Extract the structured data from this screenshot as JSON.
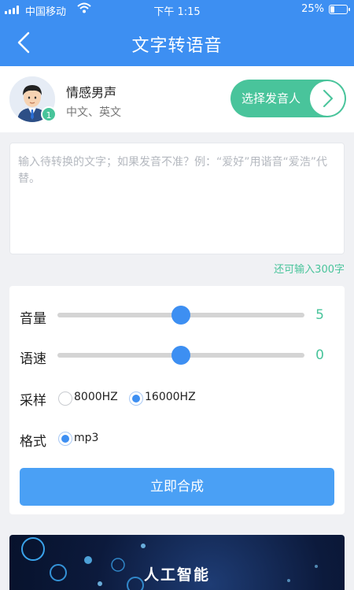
{
  "status_bar": {
    "carrier": "中国移动",
    "time": "下午 1:15",
    "battery_percent": "25%",
    "battery_level": 0.25,
    "icons": [
      "signal-icon",
      "wifi-icon",
      "battery-icon"
    ]
  },
  "header": {
    "title": "文字转语音",
    "back_icon": "chevron-left-icon"
  },
  "voice": {
    "name": "情感男声",
    "languages": "中文、英文",
    "badge": "1",
    "select_label": "选择发音人",
    "select_icon": "chevron-right-icon"
  },
  "text_input": {
    "placeholder": "输入待转换的文字；如果发音不准？例：“爱好”用谐音“爱浩”代替。",
    "value": "",
    "remaining": "还可输入300字"
  },
  "settings": {
    "volume": {
      "label": "音量",
      "value": "5",
      "level": 0.5
    },
    "speed": {
      "label": "语速",
      "value": "0",
      "level": 0.5
    },
    "sample_rate": {
      "label": "采样",
      "options": [
        {
          "label": "8000HZ",
          "selected": false
        },
        {
          "label": "16000HZ",
          "selected": true
        }
      ]
    },
    "format": {
      "label": "格式",
      "options": [
        {
          "label": "mp3",
          "selected": true
        }
      ]
    },
    "submit_label": "立即合成"
  },
  "banner": {
    "text": "人工智能"
  },
  "colors": {
    "primary": "#3d8ff2",
    "accent_green": "#49c49b",
    "button_blue": "#4aa0f5",
    "page_bg": "#f0f1f4"
  }
}
